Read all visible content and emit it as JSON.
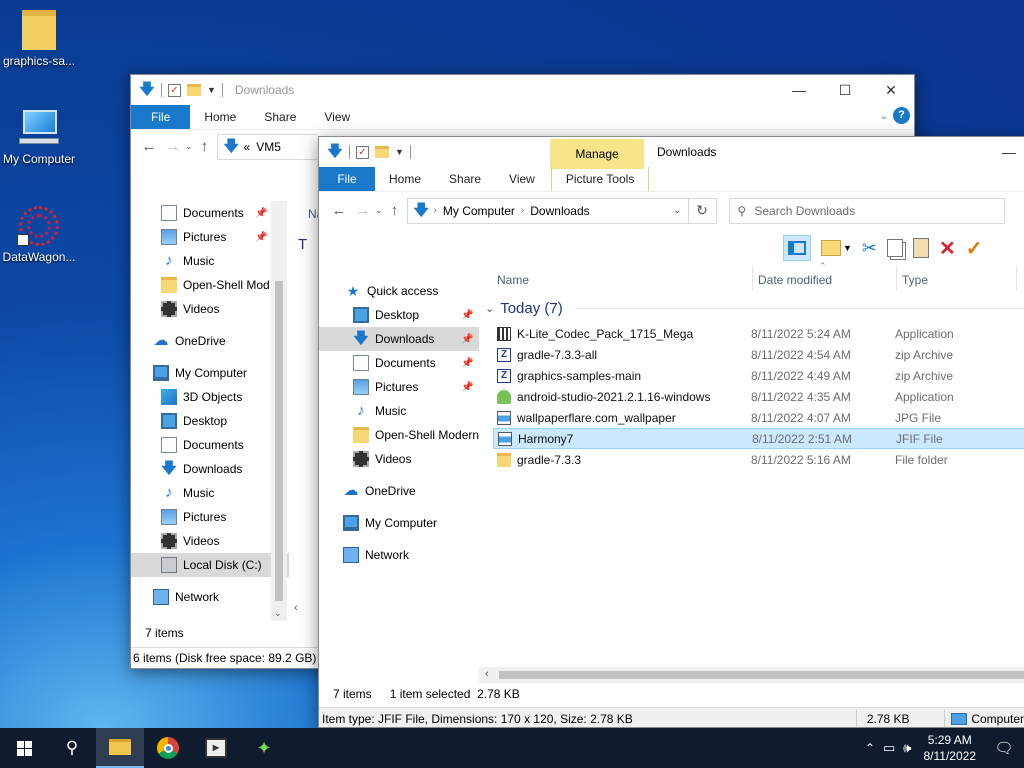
{
  "desktop": {
    "icons": [
      {
        "label": "graphics-sa..."
      },
      {
        "label": "My Computer"
      },
      {
        "label": "DataWagon..."
      }
    ]
  },
  "back_window": {
    "title": "Downloads",
    "tabs": [
      "File",
      "Home",
      "Share",
      "View"
    ],
    "breadcrumb_prefix": "«",
    "breadcrumb": "VM5",
    "nav_items": [
      "Documents",
      "Pictures",
      "Music",
      "Open-Shell Mod",
      "Videos",
      "OneDrive",
      "My Computer",
      "3D Objects",
      "Desktop",
      "Documents",
      "Downloads",
      "Music",
      "Pictures",
      "Videos",
      "Local Disk (C:)",
      "Network"
    ],
    "header_partial": "Na",
    "group_partial": "T",
    "status_items": "7 items",
    "status_disk": "6 items (Disk free space: 89.2 GB)"
  },
  "front_window": {
    "title": "Downloads",
    "manage_label": "Manage",
    "picture_tools_label": "Picture Tools",
    "tabs": [
      "File",
      "Home",
      "Share",
      "View"
    ],
    "breadcrumb": [
      "My Computer",
      "Downloads"
    ],
    "search_placeholder": "Search Downloads",
    "nav_items": [
      {
        "label": "Quick access"
      },
      {
        "label": "Desktop"
      },
      {
        "label": "Downloads"
      },
      {
        "label": "Documents"
      },
      {
        "label": "Pictures"
      },
      {
        "label": "Music"
      },
      {
        "label": "Open-Shell Modern"
      },
      {
        "label": "Videos"
      },
      {
        "label": "OneDrive"
      },
      {
        "label": "My Computer"
      },
      {
        "label": "Network"
      }
    ],
    "columns": {
      "name": "Name",
      "date": "Date modified",
      "type": "Type"
    },
    "group_header": "Today (7)",
    "files": [
      {
        "name": "K-Lite_Codec_Pack_1715_Mega",
        "date": "8/11/2022 5:24 AM",
        "type": "Application",
        "icon": "installer-icon"
      },
      {
        "name": "gradle-7.3.3-all",
        "date": "8/11/2022 4:54 AM",
        "type": "zip Archive",
        "icon": "zip-icon"
      },
      {
        "name": "graphics-samples-main",
        "date": "8/11/2022 4:49 AM",
        "type": "zip Archive",
        "icon": "zip-icon"
      },
      {
        "name": "android-studio-2021.2.1.16-windows",
        "date": "8/11/2022 4:35 AM",
        "type": "Application",
        "icon": "android-icon"
      },
      {
        "name": "wallpaperflare.com_wallpaper",
        "date": "8/11/2022 4:07 AM",
        "type": "JPG File",
        "icon": "image-icon"
      },
      {
        "name": "Harmony7",
        "date": "8/11/2022 2:51 AM",
        "type": "JFIF File",
        "icon": "image-icon"
      },
      {
        "name": "gradle-7.3.3",
        "date": "8/11/2022 5:16 AM",
        "type": "File folder",
        "icon": "folder-icon"
      }
    ],
    "selected_index": 5,
    "status_count": "7 items",
    "status_selected": "1 item selected  2.78 KB",
    "details_bar": "Item type: JFIF File, Dimensions: 170 x 120, Size: 2.78 KB",
    "details_size": "2.78 KB",
    "details_location": "Computer"
  },
  "taskbar": {
    "time": "5:29 AM",
    "date": "8/11/2022",
    "apps": [
      "file-explorer",
      "chrome",
      "media-player",
      "datawagon"
    ]
  }
}
